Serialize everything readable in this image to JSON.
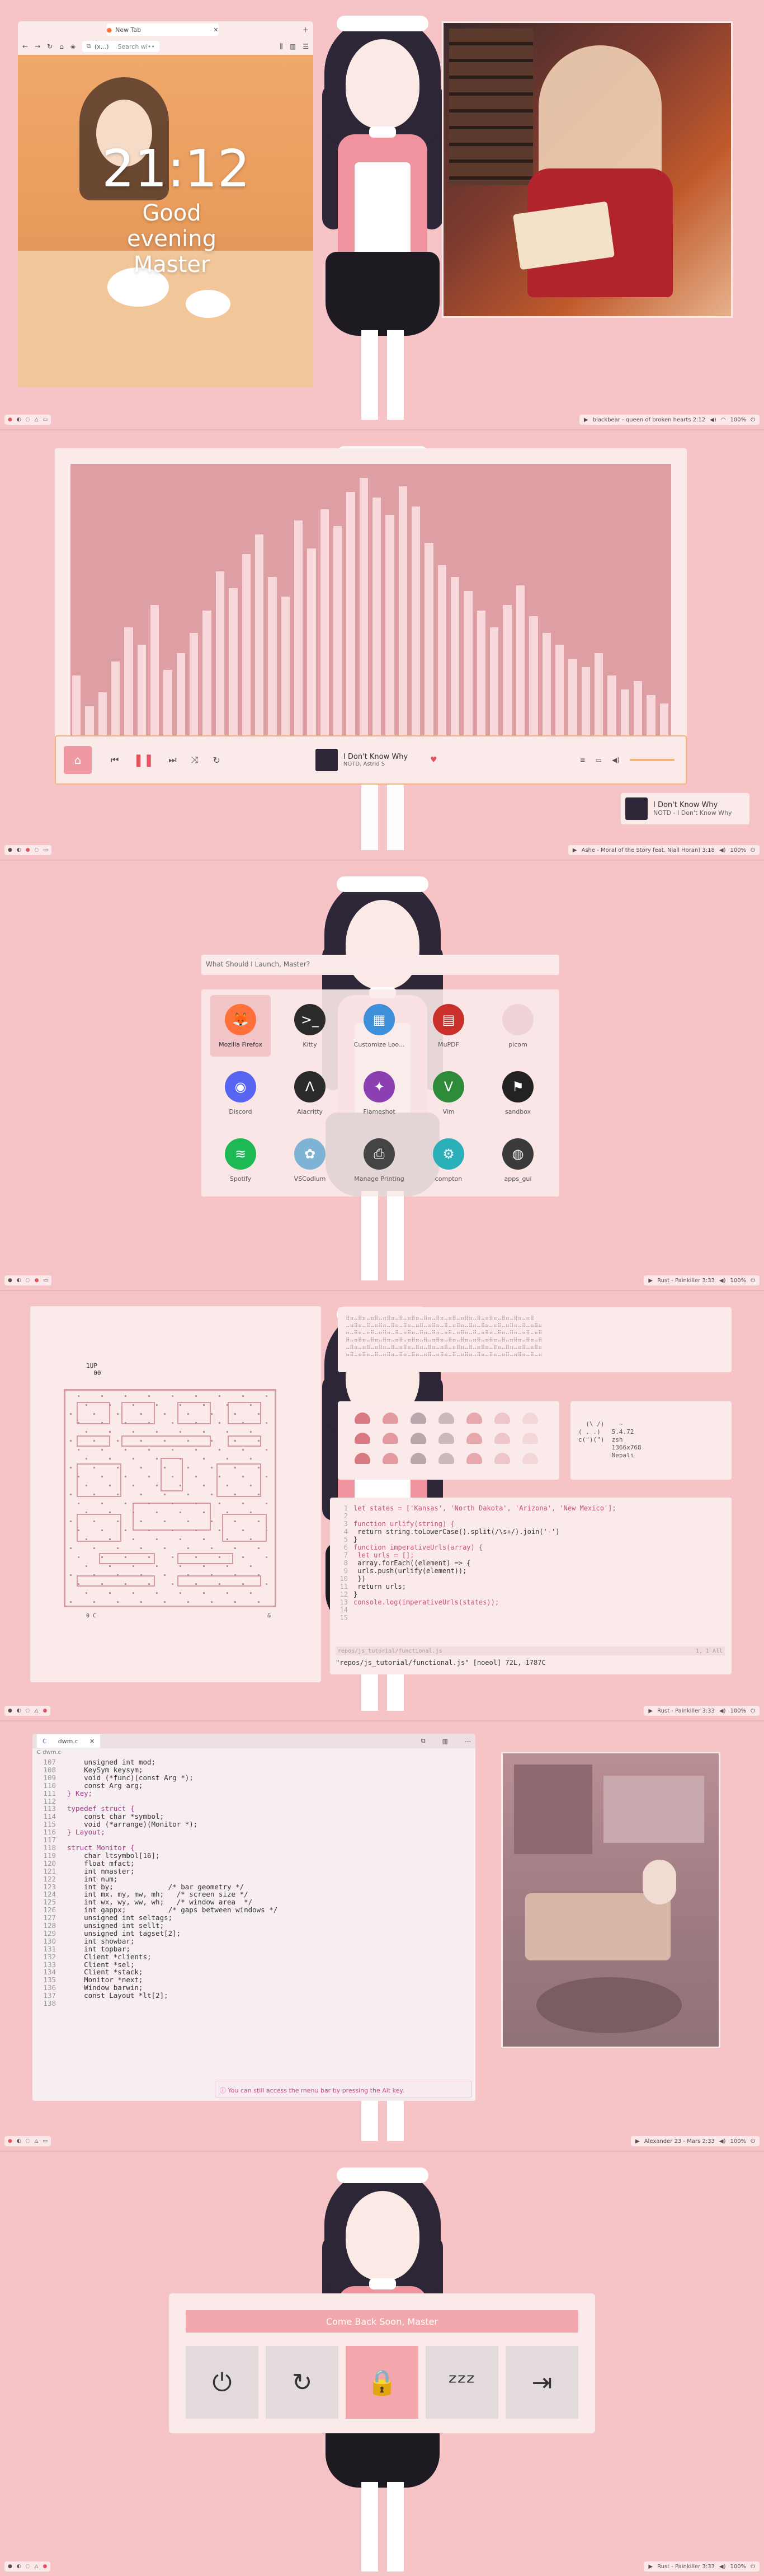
{
  "shot1": {
    "browser": {
      "tab_title": "New Tab",
      "url_text": "(x...)",
      "search_placeholder": "Search wi••",
      "clock": "21:12",
      "greeting": "Good evening Master"
    },
    "statusbar": {
      "workspaces": [
        "●",
        "◐",
        "◌",
        "△",
        "▭"
      ],
      "now_playing": "blackbear - queen of broken hearts 2:12",
      "battery": "100%"
    }
  },
  "shot2": {
    "visualizer_bars": [
      0.25,
      0.14,
      0.19,
      0.3,
      0.42,
      0.36,
      0.5,
      0.27,
      0.33,
      0.4,
      0.48,
      0.62,
      0.56,
      0.68,
      0.75,
      0.6,
      0.53,
      0.8,
      0.7,
      0.84,
      0.78,
      0.9,
      0.95,
      0.88,
      0.82,
      0.92,
      0.85,
      0.72,
      0.64,
      0.6,
      0.55,
      0.48,
      0.42,
      0.5,
      0.57,
      0.46,
      0.4,
      0.36,
      0.31,
      0.28,
      0.33,
      0.25,
      0.2,
      0.23,
      0.18,
      0.15
    ],
    "player": {
      "track": "I Don't Know Why",
      "artist": "NOTD, Astrid S"
    },
    "notification": {
      "title": "I Don't Know Why",
      "subtitle": "NOTD - I Don't Know Why"
    },
    "statusbar": {
      "now_playing": "Ashe - Moral of the Story feat. Niall Horan) 3:18",
      "battery": "100%"
    }
  },
  "shot3": {
    "search_placeholder": "What Should I Launch, Master?",
    "apps": [
      {
        "label": "Mozilla Firefox",
        "icon": "firefox-icon",
        "color": "#ff7139",
        "glyph": "🦊"
      },
      {
        "label": "Kitty",
        "icon": "terminal-icon",
        "color": "#2b2b2b",
        "glyph": ">_"
      },
      {
        "label": "Customize Loo...",
        "icon": "appearance-icon",
        "color": "#3c8fd8",
        "glyph": "▦"
      },
      {
        "label": "MuPDF",
        "icon": "pdf-icon",
        "color": "#c9302c",
        "glyph": "▤"
      },
      {
        "label": "picom",
        "icon": "picom-icon",
        "color": "#f0d3d6",
        "glyph": ""
      },
      {
        "label": "Discord",
        "icon": "discord-icon",
        "color": "#5865f2",
        "glyph": "◉"
      },
      {
        "label": "Alacritty",
        "icon": "alacritty-icon",
        "color": "#2b2b2b",
        "glyph": "Λ"
      },
      {
        "label": "Flameshot",
        "icon": "flameshot-icon",
        "color": "#8b3fb0",
        "glyph": "✦"
      },
      {
        "label": "Vim",
        "icon": "vim-icon",
        "color": "#2e8b3a",
        "glyph": "V"
      },
      {
        "label": "sandbox",
        "icon": "sandbox-icon",
        "color": "#222222",
        "glyph": "⚑"
      },
      {
        "label": "Spotify",
        "icon": "spotify-icon",
        "color": "#1db954",
        "glyph": "≋"
      },
      {
        "label": "VSCodium",
        "icon": "vscodium-icon",
        "color": "#7fb3d5",
        "glyph": "✿"
      },
      {
        "label": "Manage Printing",
        "icon": "printer-icon",
        "color": "#444444",
        "glyph": "⎙"
      },
      {
        "label": "compton",
        "icon": "compton-icon",
        "color": "#2ab0b8",
        "glyph": "⚙"
      },
      {
        "label": "apps_gui",
        "icon": "apps-gui-icon",
        "color": "#3a3a3a",
        "glyph": "◍"
      }
    ],
    "statusbar": {
      "now_playing": "Rust - Painkiller 3:33",
      "battery": "100%"
    }
  },
  "shot4": {
    "pacman_score": "1UP\n  00",
    "pacman_footer_left": "0 C",
    "pacman_footer_right": "&",
    "fetch_lines": "(\\ /)    ~\n( . .)   5.4.72\nc(\")(\")  zsh\n         1366x768\n         Nepali",
    "code_lines": [
      "let states = ['Kansas', 'North Dakota', 'Arizona', 'New Mexico'];",
      "",
      "function urlify(string) {",
      "    return string.toLowerCase().split(/\\s+/).join('-')",
      "}",
      "function imperativeUrls(array) {",
      "    let urls = [];",
      "    array.forEach((element) => {",
      "        urls.push(urlify(element));",
      "    })",
      "    return urls;",
      "}",
      "console.log(imperativeUrls(states));"
    ],
    "vim_status_left": "repos/js_tutorial/functional.js",
    "vim_status_right": "1, 1   All",
    "vim_cmdline": "\"repos/js_tutorial/functional.js\" [noeol] 72L, 1787C",
    "statusbar": {
      "now_playing": "Rust - Painkiller 3:33",
      "battery": "100%"
    }
  },
  "shot5": {
    "tab_label": "dwm.c",
    "breadcrumb": "C dwm.c",
    "hint": "You can still access the menu bar by pressing the Alt key.",
    "code": [
      {
        "n": "107",
        "t": "    unsigned int mod;"
      },
      {
        "n": "108",
        "t": "    KeySym keysym;"
      },
      {
        "n": "109",
        "t": "    void (*func)(const Arg *);"
      },
      {
        "n": "110",
        "t": "    const Arg arg;"
      },
      {
        "n": "111",
        "t": "} Key;"
      },
      {
        "n": "112",
        "t": ""
      },
      {
        "n": "113",
        "t": "typedef struct {"
      },
      {
        "n": "114",
        "t": "    const char *symbol;"
      },
      {
        "n": "115",
        "t": "    void (*arrange)(Monitor *);"
      },
      {
        "n": "116",
        "t": "} Layout;"
      },
      {
        "n": "117",
        "t": ""
      },
      {
        "n": "118",
        "t": "struct Monitor {"
      },
      {
        "n": "119",
        "t": "    char ltsymbol[16];"
      },
      {
        "n": "120",
        "t": "    float mfact;"
      },
      {
        "n": "121",
        "t": "    int nmaster;"
      },
      {
        "n": "122",
        "t": "    int num;"
      },
      {
        "n": "123",
        "t": "    int by;             /* bar geometry */"
      },
      {
        "n": "124",
        "t": "    int mx, my, mw, mh;   /* screen size */"
      },
      {
        "n": "125",
        "t": "    int wx, wy, ww, wh;   /* window area  */"
      },
      {
        "n": "126",
        "t": "    int gappx;          /* gaps between windows */"
      },
      {
        "n": "127",
        "t": "    unsigned int seltags;"
      },
      {
        "n": "128",
        "t": "    unsigned int sellt;"
      },
      {
        "n": "129",
        "t": "    unsigned int tagset[2];"
      },
      {
        "n": "130",
        "t": "    int showbar;"
      },
      {
        "n": "131",
        "t": "    int topbar;"
      },
      {
        "n": "132",
        "t": "    Client *clients;"
      },
      {
        "n": "133",
        "t": "    Client *sel;"
      },
      {
        "n": "134",
        "t": "    Client *stack;"
      },
      {
        "n": "135",
        "t": "    Monitor *next;"
      },
      {
        "n": "136",
        "t": "    Window barwin;"
      },
      {
        "n": "137",
        "t": "    const Layout *lt[2];"
      },
      {
        "n": "138",
        "t": ""
      }
    ],
    "statusbar": {
      "now_playing": "Alexander 23 - Mars 2:33",
      "battery": "100%"
    }
  },
  "shot6": {
    "title": "Come Back Soon, Master",
    "buttons": [
      {
        "name": "shutdown-button",
        "icon": "power-icon",
        "glyph": "⏻"
      },
      {
        "name": "reboot-button",
        "icon": "reboot-icon",
        "glyph": "↻"
      },
      {
        "name": "lock-button",
        "icon": "lock-icon",
        "glyph": "🔒"
      },
      {
        "name": "suspend-button",
        "icon": "sleep-icon",
        "glyph": "ᶻᶻᶻ"
      },
      {
        "name": "logout-button",
        "icon": "logout-icon",
        "glyph": "⇥"
      }
    ],
    "statusbar": {
      "now_playing": "Rust - Painkiller 3:33",
      "battery": "100%"
    }
  }
}
